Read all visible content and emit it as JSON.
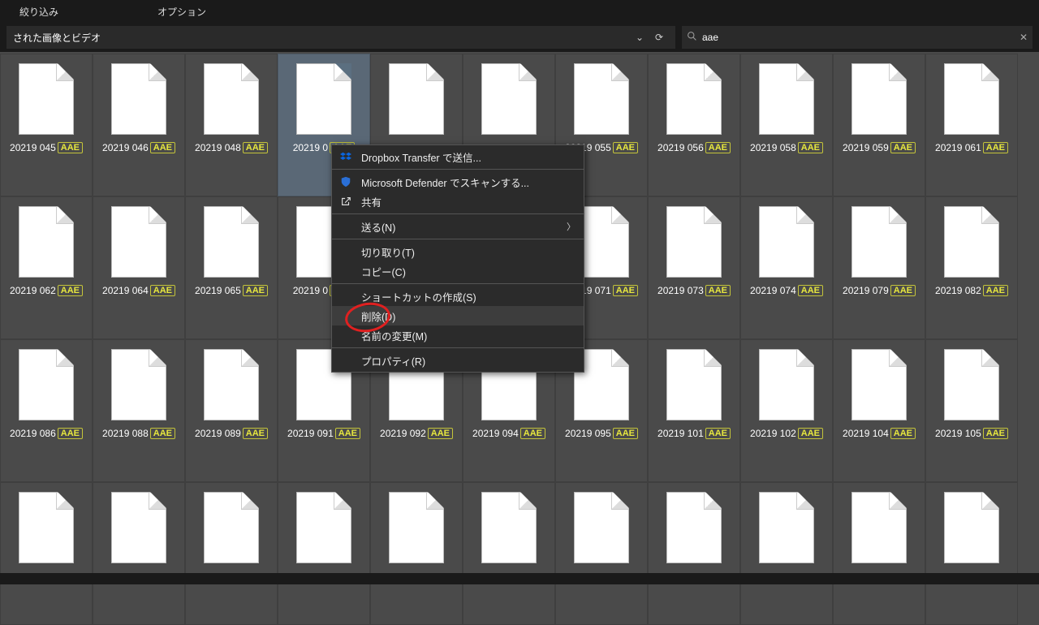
{
  "menu": {
    "filter": "絞り込み",
    "options": "オプション"
  },
  "address": {
    "label": "された画像とビデオ"
  },
  "search": {
    "value": "aae"
  },
  "ext_badge": "AAE",
  "files": [
    {
      "name": "20219 045"
    },
    {
      "name": "20219 046"
    },
    {
      "name": "20219 048"
    },
    {
      "name": "20219 0",
      "selected": true
    },
    {
      "name": ""
    },
    {
      "name": ""
    },
    {
      "name": "20219 055"
    },
    {
      "name": "20219 056"
    },
    {
      "name": "20219 058"
    },
    {
      "name": "20219 059"
    },
    {
      "name": "20219 061"
    },
    {
      "name": "20219 062"
    },
    {
      "name": "20219 064"
    },
    {
      "name": "20219 065"
    },
    {
      "name": "20219 0"
    },
    {
      "name": ""
    },
    {
      "name": ""
    },
    {
      "name": "20219 071"
    },
    {
      "name": "20219 073"
    },
    {
      "name": "20219 074"
    },
    {
      "name": "20219 079"
    },
    {
      "name": "20219 082"
    },
    {
      "name": "20219 086"
    },
    {
      "name": "20219 088"
    },
    {
      "name": "20219 089"
    },
    {
      "name": "20219 091"
    },
    {
      "name": "20219 092"
    },
    {
      "name": "20219 094"
    },
    {
      "name": "20219 095"
    },
    {
      "name": "20219 101"
    },
    {
      "name": "20219 102"
    },
    {
      "name": "20219 104"
    },
    {
      "name": "20219 105"
    },
    {
      "name": ""
    },
    {
      "name": ""
    },
    {
      "name": ""
    },
    {
      "name": ""
    },
    {
      "name": ""
    },
    {
      "name": ""
    },
    {
      "name": ""
    },
    {
      "name": ""
    },
    {
      "name": ""
    },
    {
      "name": ""
    },
    {
      "name": ""
    }
  ],
  "context_menu": {
    "dropbox": "Dropbox Transfer で送信...",
    "defender": "Microsoft Defender でスキャンする...",
    "share": "共有",
    "send_to": "送る(N)",
    "cut": "切り取り(T)",
    "copy": "コピー(C)",
    "shortcut": "ショートカットの作成(S)",
    "delete": "削除(D)",
    "rename": "名前の変更(M)",
    "properties": "プロパティ(R)"
  }
}
